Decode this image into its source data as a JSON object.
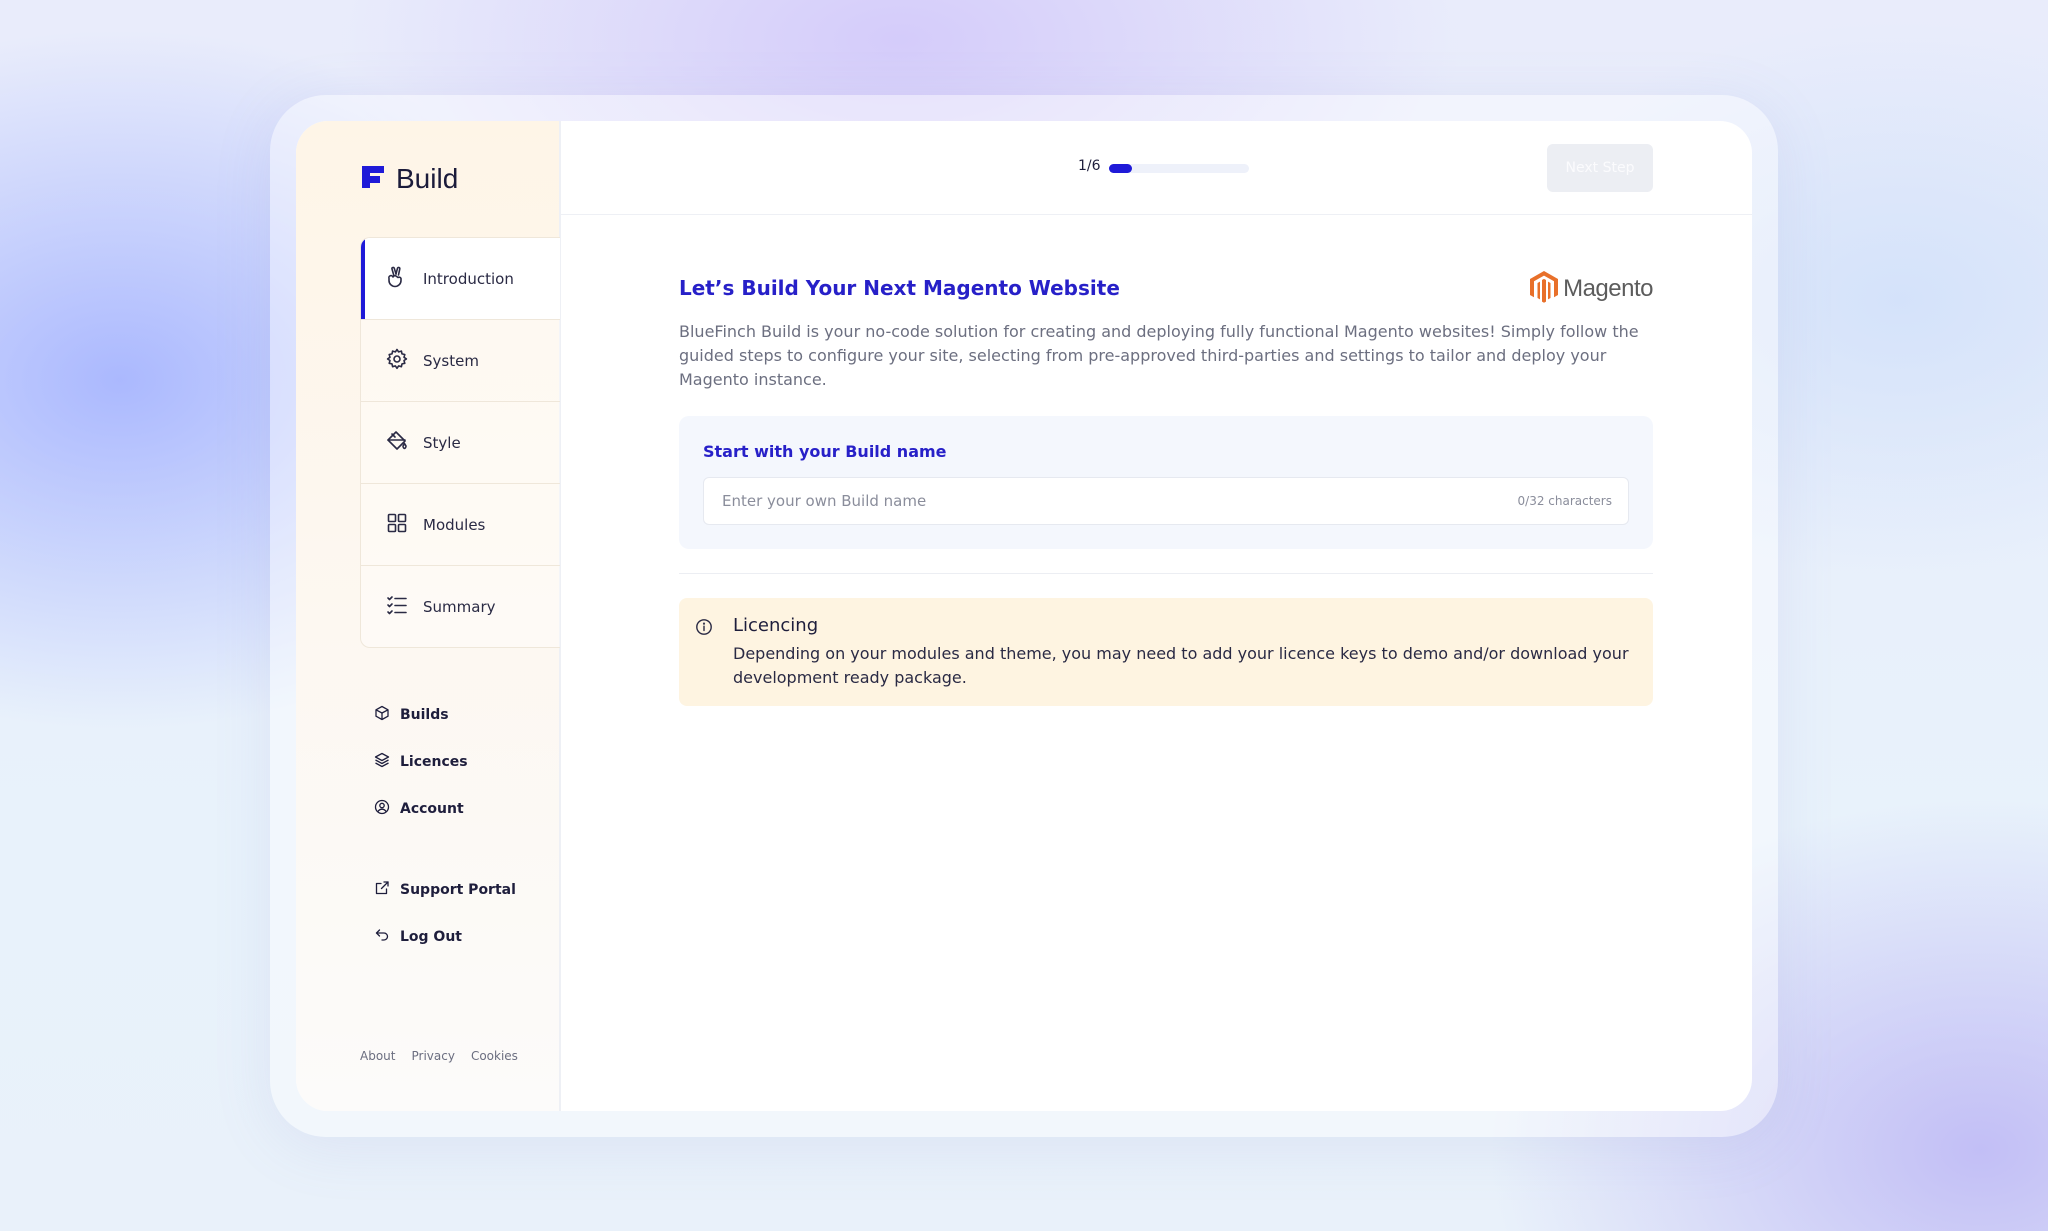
{
  "app": {
    "name": "Build"
  },
  "steps": [
    {
      "label": "Introduction",
      "icon": "peace-hand-icon",
      "active": true
    },
    {
      "label": "System",
      "icon": "gear-icon",
      "active": false
    },
    {
      "label": "Style",
      "icon": "paint-bucket-icon",
      "active": false
    },
    {
      "label": "Modules",
      "icon": "grid-icon",
      "active": false
    },
    {
      "label": "Summary",
      "icon": "checklist-icon",
      "active": false
    }
  ],
  "nav_links": [
    {
      "label": "Builds",
      "icon": "cube-icon"
    },
    {
      "label": "Licences",
      "icon": "layers-icon"
    },
    {
      "label": "Account",
      "icon": "user-circle-icon"
    }
  ],
  "nav_links2": [
    {
      "label": "Support Portal",
      "icon": "external-link-icon"
    },
    {
      "label": "Log Out",
      "icon": "undo-arrow-icon"
    }
  ],
  "footer": {
    "about": "About",
    "privacy": "Privacy",
    "cookies": "Cookies"
  },
  "progress": {
    "label": "1/6",
    "fraction": 0.167
  },
  "toolbar": {
    "next_label": "Next Step"
  },
  "main": {
    "title": "Let’s Build Your Next Magento Website",
    "brand": "Magento",
    "description": "BlueFinch Build is your no-code solution for creating and deploying fully functional Magento websites! Simply follow the guided steps to configure your site, selecting from pre-approved third-parties and settings to tailor and deploy your Magento instance."
  },
  "build_name": {
    "label": "Start with your Build name",
    "placeholder": "Enter your own Build name",
    "value": "",
    "counter": "0/32 characters"
  },
  "licencing": {
    "title": "Licencing",
    "body": "Depending on your modules and theme, you may need to add your licence keys to demo and/or download your development ready package."
  },
  "colors": {
    "accent": "#1f1ad8",
    "title": "#2720c8",
    "notice_bg": "#fef4e1",
    "brand": "#e8702a"
  }
}
